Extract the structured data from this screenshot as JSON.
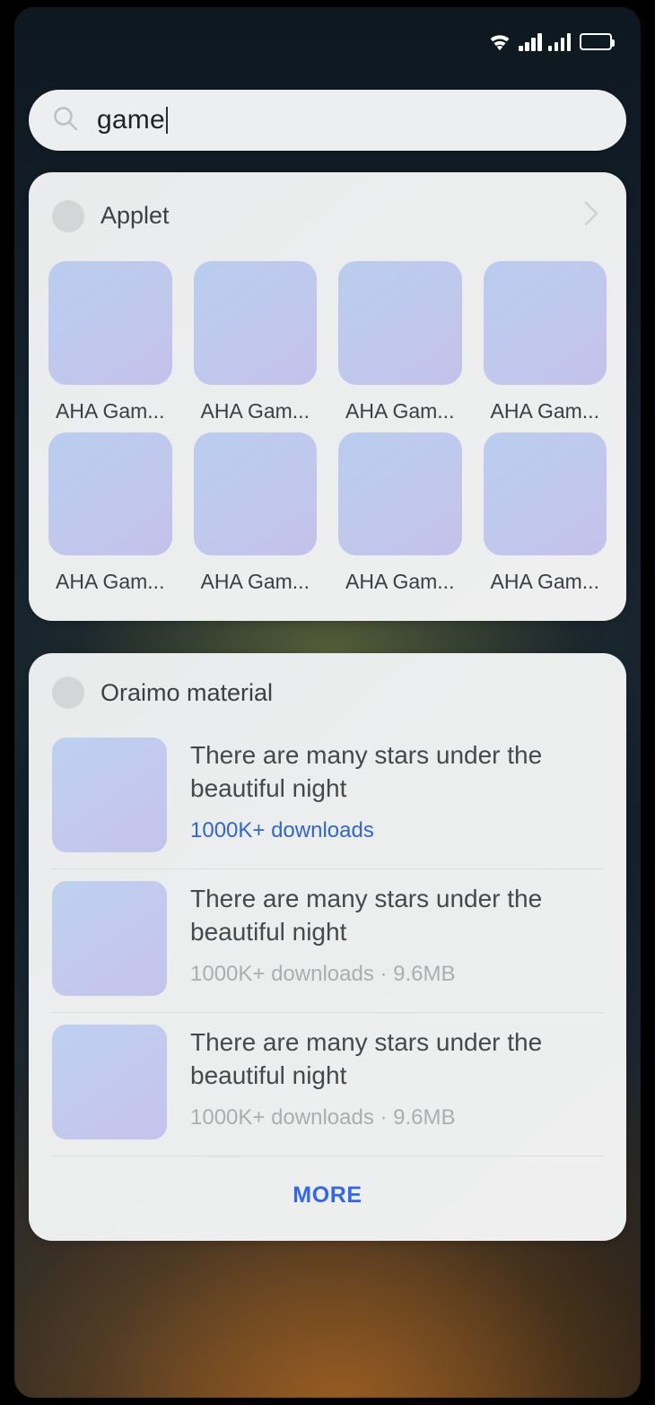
{
  "statusbar": {
    "wifi_icon": "wifi-icon",
    "signal_icon_1": "signal-bars-icon",
    "signal_icon_2": "signal-bars-icon",
    "battery_icon": "battery-full-icon"
  },
  "search": {
    "icon": "search-icon",
    "value": "game",
    "placeholder": "Search"
  },
  "applet_card": {
    "icon": "applet-avatar-icon",
    "title": "Applet",
    "chevron_icon": "chevron-right-icon",
    "items": [
      {
        "label": "AHA Gam..."
      },
      {
        "label": "AHA Gam..."
      },
      {
        "label": "AHA Gam..."
      },
      {
        "label": "AHA Gam..."
      },
      {
        "label": "AHA Gam..."
      },
      {
        "label": "AHA Gam..."
      },
      {
        "label": "AHA Gam..."
      },
      {
        "label": "AHA Gam..."
      }
    ]
  },
  "material_card": {
    "icon": "oraimo-avatar-icon",
    "title": "Oraimo material",
    "items": [
      {
        "title": "There are many stars under the beautiful night",
        "meta": "1000K+ downloads",
        "meta_accent": true
      },
      {
        "title": "There are many stars under the beautiful night",
        "meta": "1000K+ downloads · 9.6MB",
        "meta_accent": false
      },
      {
        "title": "There are many stars under the beautiful night",
        "meta": "1000K+ downloads · 9.6MB",
        "meta_accent": false
      }
    ],
    "more_label": "MORE"
  },
  "colors": {
    "accent_blue": "#3366ee",
    "link_blue": "#3366cc",
    "card_bg": "#eceeee",
    "tile_gradient_start": "#bdd1f0",
    "tile_gradient_end": "#c6c2eb",
    "meta_gray": "#a9aeb0"
  }
}
